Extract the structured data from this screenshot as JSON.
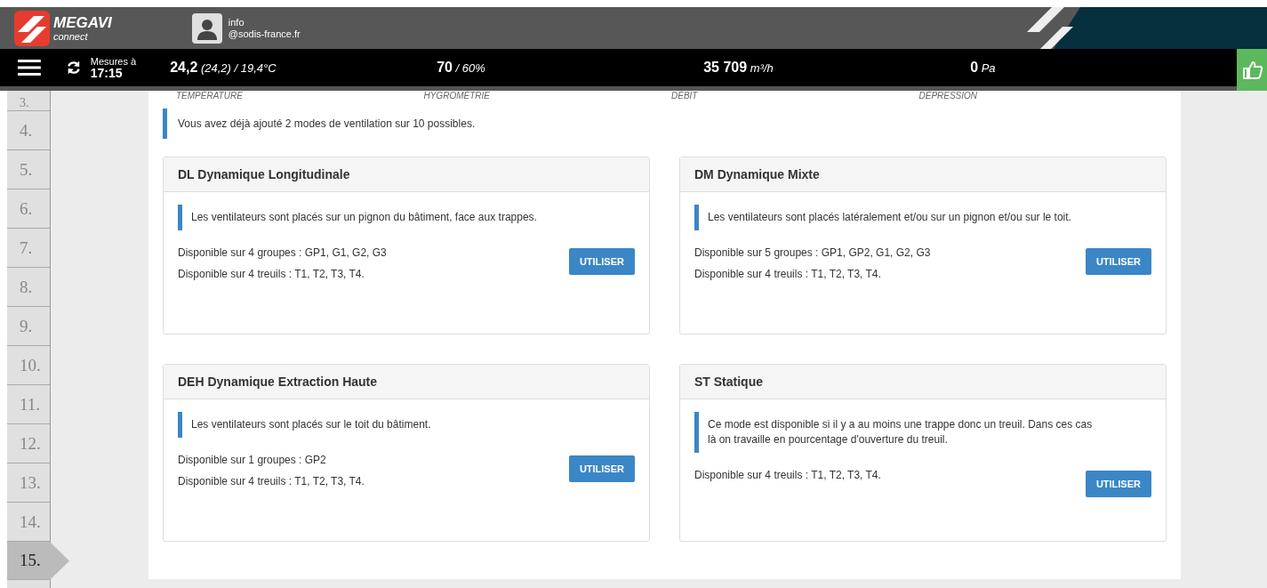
{
  "header": {
    "brand": "MEGAVI",
    "brand_sub": "connect",
    "user_line1": "info",
    "user_line2": "@sodis-france.fr"
  },
  "measures_bar": {
    "caption": "Mesures à",
    "time": "17:15",
    "metrics": [
      {
        "value": "24,2",
        "detail": "(24,2) / 19,4°C",
        "label": "TEMPÉRATURE"
      },
      {
        "value": "70",
        "detail": "/ 60%",
        "label": "HYGROMÉTRIE"
      },
      {
        "value": "35 709",
        "detail": "m³/h",
        "label": "DÉBIT"
      },
      {
        "value": "0",
        "detail": "Pa",
        "label": "DÉPRESSION"
      }
    ]
  },
  "steps": [
    {
      "label": "3.",
      "selected": false
    },
    {
      "label": "4.",
      "selected": false
    },
    {
      "label": "5.",
      "selected": false
    },
    {
      "label": "6.",
      "selected": false
    },
    {
      "label": "7.",
      "selected": false
    },
    {
      "label": "8.",
      "selected": false
    },
    {
      "label": "9.",
      "selected": false
    },
    {
      "label": "10.",
      "selected": false
    },
    {
      "label": "11.",
      "selected": false
    },
    {
      "label": "12.",
      "selected": false
    },
    {
      "label": "13.",
      "selected": false
    },
    {
      "label": "14.",
      "selected": false
    },
    {
      "label": "15.",
      "selected": true
    }
  ],
  "notice": "Vous avez déjà ajouté 2 modes de ventilation sur 10 possibles.",
  "modes": [
    {
      "title": "DL Dynamique Longitudinale",
      "description": "Les ventilateurs sont placés sur un pignon du bâtiment, face aux trappes.",
      "lines": [
        "Disponible sur 4 groupes : GP1, G1, G2, G3",
        "Disponible sur 4 treuils : T1, T2, T3, T4."
      ],
      "button": "UTILISER"
    },
    {
      "title": "DM Dynamique Mixte",
      "description": "Les ventilateurs sont placés latéralement et/ou sur un pignon et/ou sur le toit.",
      "lines": [
        "Disponible sur 5 groupes : GP1, GP2, G1, G2, G3",
        "Disponible sur 4 treuils : T1, T2, T3, T4."
      ],
      "button": "UTILISER"
    },
    {
      "title": "DEH Dynamique Extraction Haute",
      "description": "Les ventilateurs sont placés sur le toit du bâtiment.",
      "lines": [
        "Disponible sur 1 groupes : GP2",
        "Disponible sur 4 treuils : T1, T2, T3, T4."
      ],
      "button": "UTILISER"
    },
    {
      "title": "ST Statique",
      "description": "Ce mode est disponible si il y a au moins une trappe donc un treuil. Dans ces cas là on travaille en pourcentage d'ouverture du treuil.",
      "lines": [
        "Disponible sur 4 treuils : T1, T2, T3, T4."
      ],
      "button": "UTILISER"
    }
  ]
}
